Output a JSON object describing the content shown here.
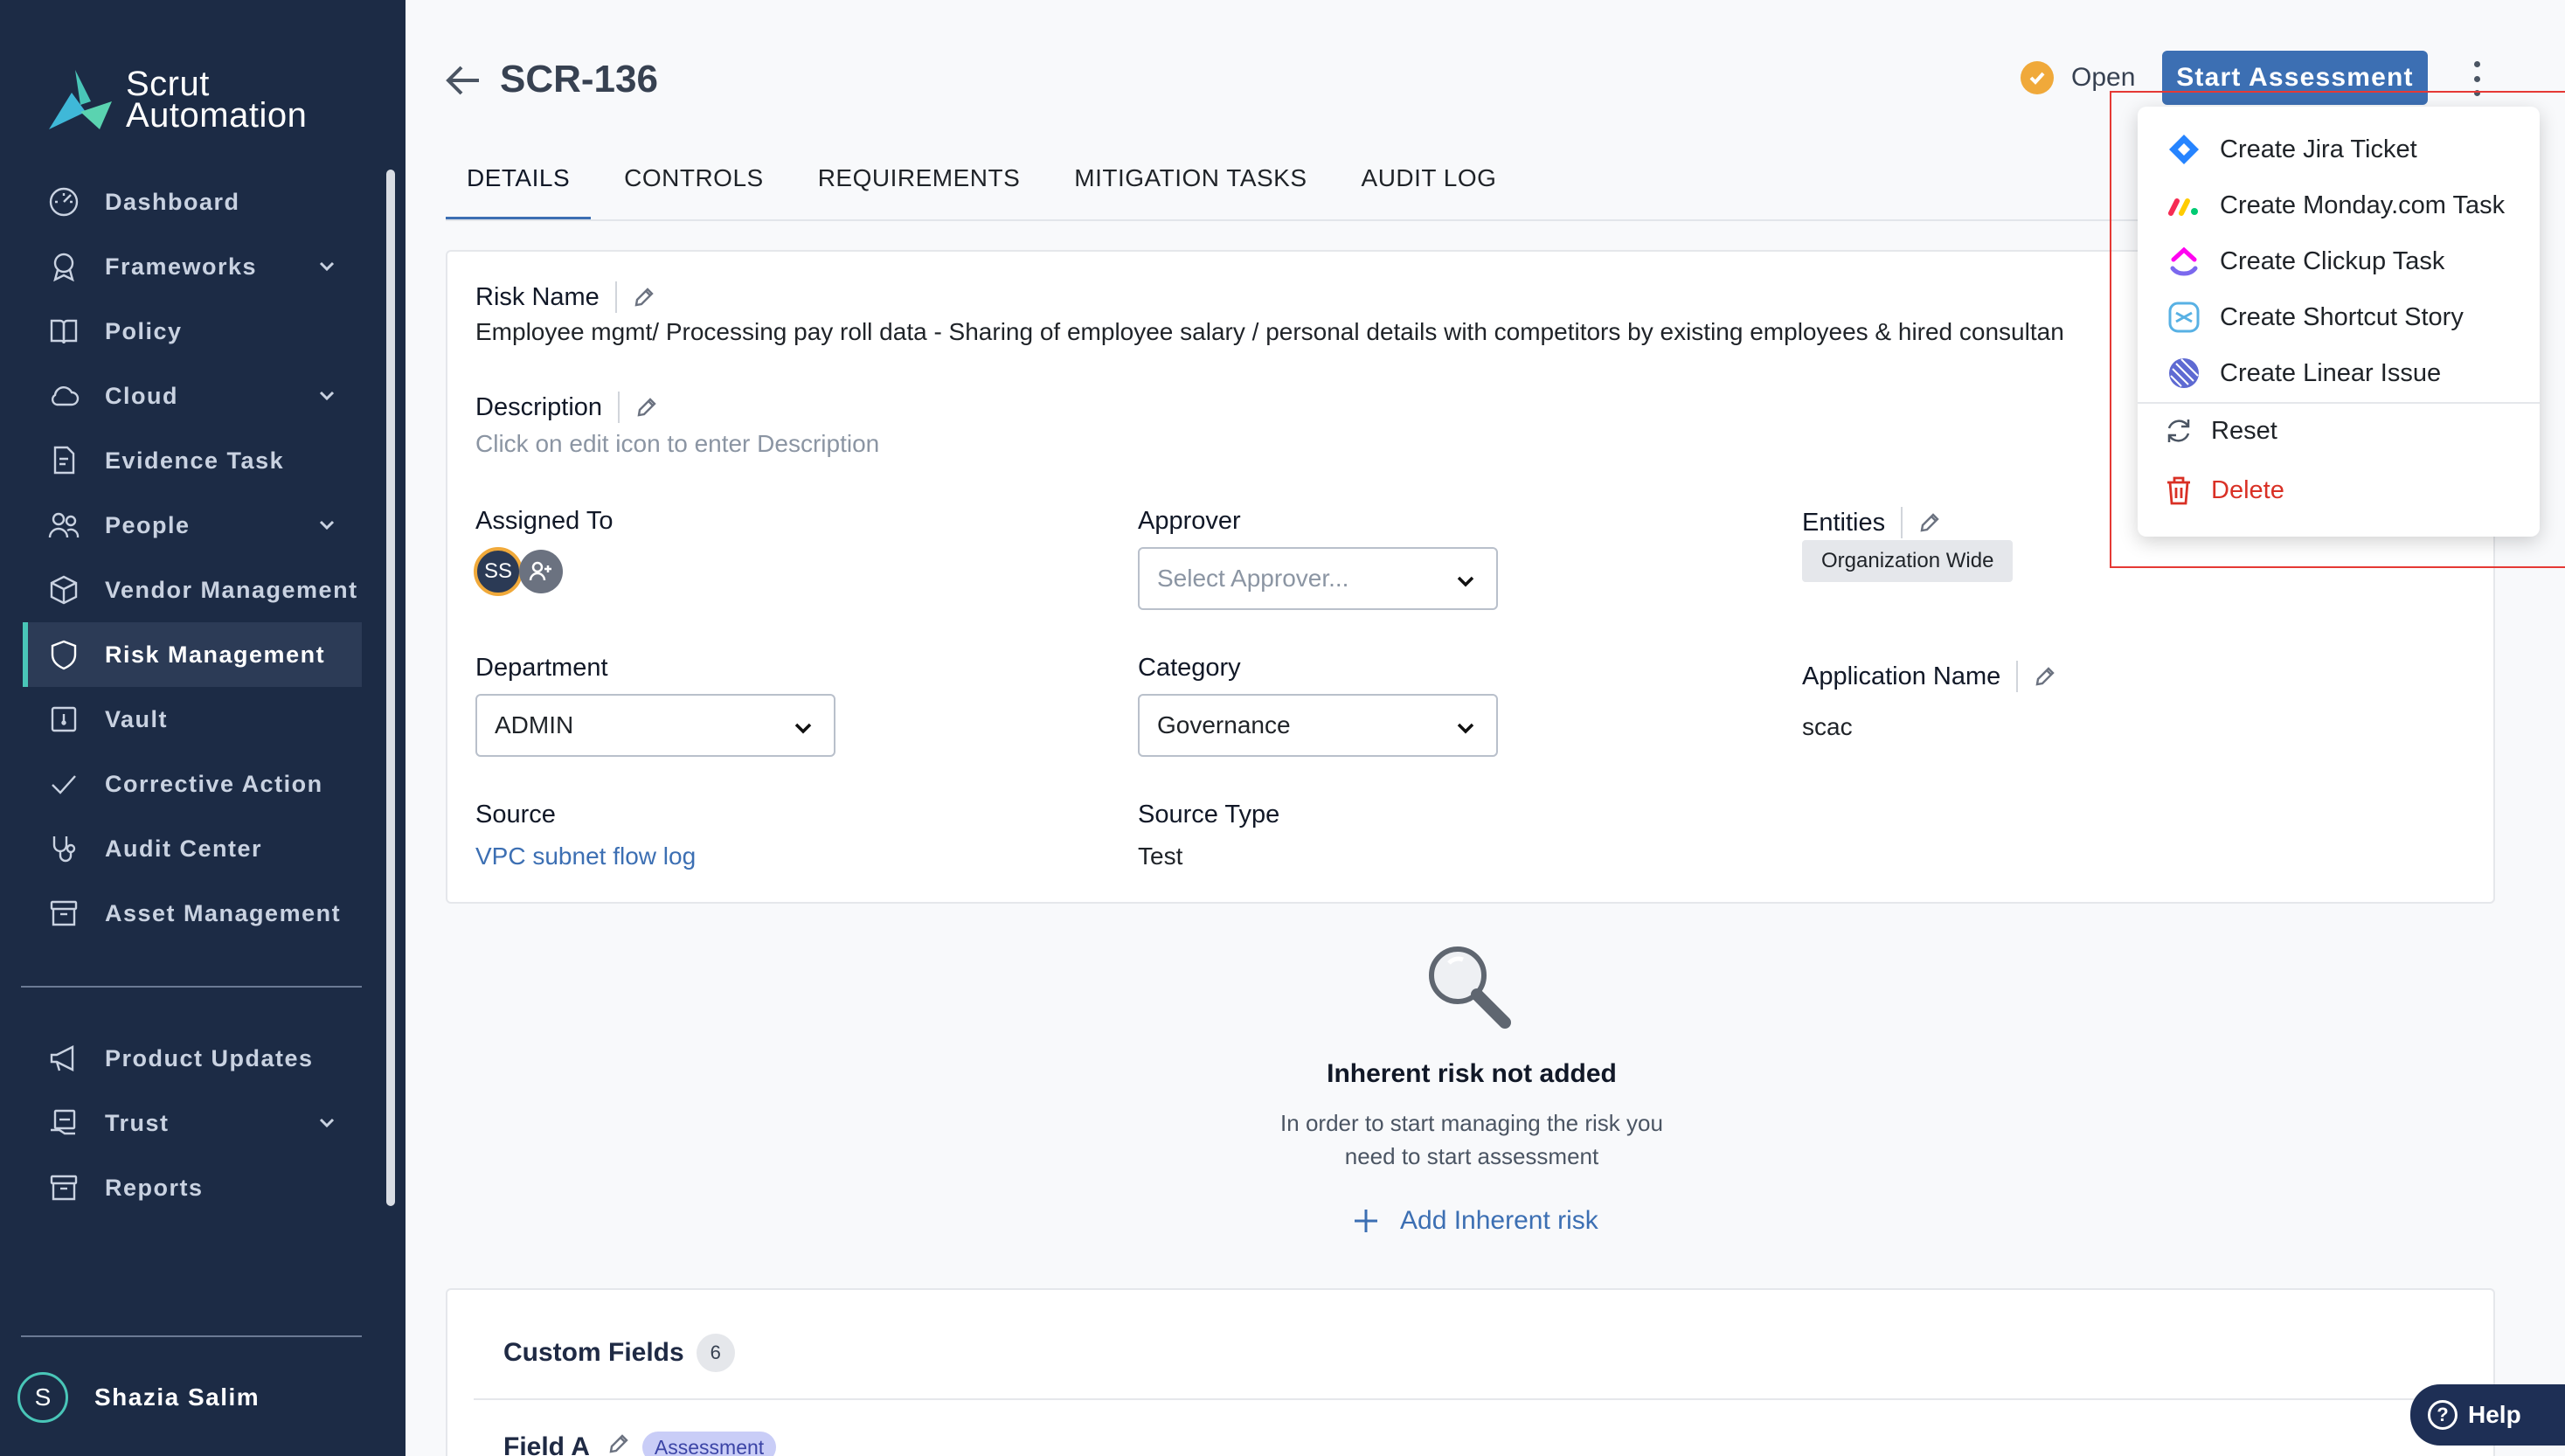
{
  "brand": {
    "line1": "Scrut",
    "line2": "Automation"
  },
  "sidebar": {
    "items": [
      {
        "label": "Dashboard",
        "icon": "dashboard-icon",
        "chevron": false
      },
      {
        "label": "Frameworks",
        "icon": "frameworks-icon",
        "chevron": true
      },
      {
        "label": "Policy",
        "icon": "book-icon",
        "chevron": false
      },
      {
        "label": "Cloud",
        "icon": "cloud-icon",
        "chevron": true
      },
      {
        "label": "Evidence Task",
        "icon": "evidence-icon",
        "chevron": false
      },
      {
        "label": "People",
        "icon": "people-icon",
        "chevron": true
      },
      {
        "label": "Vendor Management",
        "icon": "cube-icon",
        "chevron": false
      },
      {
        "label": "Risk Management",
        "icon": "shield-icon",
        "chevron": false,
        "active": true
      },
      {
        "label": "Vault",
        "icon": "vault-icon",
        "chevron": false
      },
      {
        "label": "Corrective Action",
        "icon": "check-icon",
        "chevron": false
      },
      {
        "label": "Audit Center",
        "icon": "stethoscope-icon",
        "chevron": false
      },
      {
        "label": "Asset Management",
        "icon": "archive-icon",
        "chevron": false
      }
    ],
    "bottom_items": [
      {
        "label": "Product Updates",
        "icon": "megaphone-icon",
        "chevron": false
      },
      {
        "label": "Trust",
        "icon": "trust-icon",
        "chevron": true
      },
      {
        "label": "Reports",
        "icon": "reports-icon",
        "chevron": false
      }
    ],
    "user": {
      "initial": "S",
      "name": "Shazia Salim"
    }
  },
  "header": {
    "title": "SCR-136",
    "status": "Open",
    "start_button": "Start Assessment"
  },
  "tabs": [
    {
      "label": "DETAILS",
      "active": true
    },
    {
      "label": "CONTROLS"
    },
    {
      "label": "REQUIREMENTS"
    },
    {
      "label": "MITIGATION TASKS"
    },
    {
      "label": "AUDIT LOG"
    }
  ],
  "details": {
    "risk_name_label": "Risk Name",
    "risk_name_value": "Employee mgmt/ Processing pay roll data - Sharing of employee salary / personal details with competitors by existing employees & hired consultan",
    "description_label": "Description",
    "description_value": "Click on edit icon to enter Description",
    "assigned_label": "Assigned To",
    "assigned_initials": "SS",
    "approver_label": "Approver",
    "approver_placeholder": "Select Approver...",
    "entities_label": "Entities",
    "entities_chip": "Organization Wide",
    "department_label": "Department",
    "department_value": "ADMIN",
    "category_label": "Category",
    "category_value": "Governance",
    "app_name_label": "Application Name",
    "app_name_value": "scac",
    "source_label": "Source",
    "source_value": "VPC subnet flow log",
    "source_type_label": "Source Type",
    "source_type_value": "Test"
  },
  "empty_state": {
    "title": "Inherent risk not added",
    "desc": "In order to start managing the risk you need to start assessment",
    "action": "Add Inherent risk"
  },
  "custom_fields": {
    "title": "Custom Fields",
    "count": "6",
    "field_label": "Field A",
    "field_tag": "Assessment"
  },
  "menu": {
    "items": [
      {
        "label": "Create Jira Ticket",
        "icon": "jira-icon"
      },
      {
        "label": "Create Monday.com Task",
        "icon": "monday-icon"
      },
      {
        "label": "Create Clickup Task",
        "icon": "clickup-icon"
      },
      {
        "label": "Create Shortcut Story",
        "icon": "shortcut-icon"
      },
      {
        "label": "Create Linear Issue",
        "icon": "linear-icon"
      }
    ],
    "reset": "Reset",
    "delete": "Delete"
  },
  "help": {
    "label": "Help"
  },
  "colors": {
    "sidebar_bg": "#1c2b45",
    "accent": "#3c6fb3",
    "active_indicator": "#49c6b8",
    "status_dot": "#f0a93a",
    "danger": "#d93025"
  }
}
